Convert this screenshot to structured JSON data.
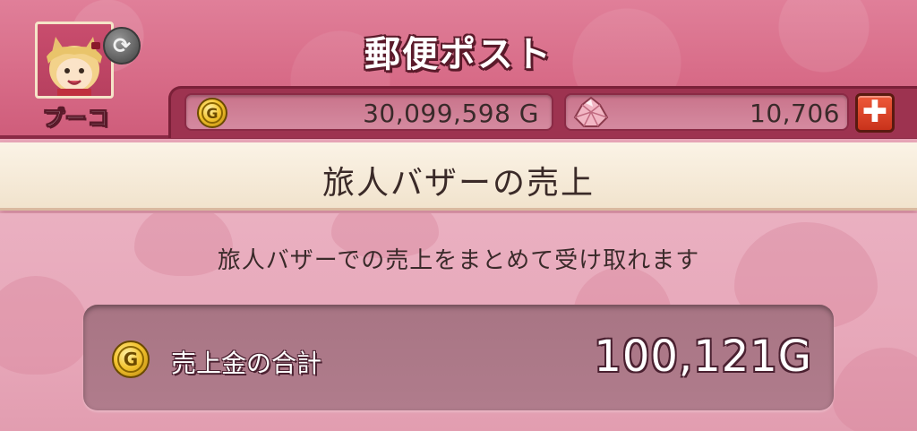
{
  "header": {
    "title": "郵便ポスト",
    "player_name": "プーコ",
    "avatar_icon": "player-avatar-icon",
    "swap_icon": "swap-character-icon"
  },
  "currency": {
    "gold": {
      "icon": "gold-coin-icon",
      "coin_letter": "G",
      "value": "30,099,598 G"
    },
    "gems": {
      "icon": "gem-icon",
      "value": "10,706"
    },
    "add_label": "✚"
  },
  "section": {
    "title": "旅人バザーの売上"
  },
  "main": {
    "description": "旅人バザーでの売上をまとめて受け取れます",
    "total_label": "売上金の合計",
    "total_value": "100,121G",
    "coin_letter": "G"
  },
  "colors": {
    "header_pink": "#d86c88",
    "header_border": "#8a2a45",
    "band_cream": "#f1e3cd",
    "body_pink": "#e7a7b9",
    "panel_mauve": "#b07c8c",
    "add_button_red": "#d8402a",
    "gold": "#f4c430"
  }
}
